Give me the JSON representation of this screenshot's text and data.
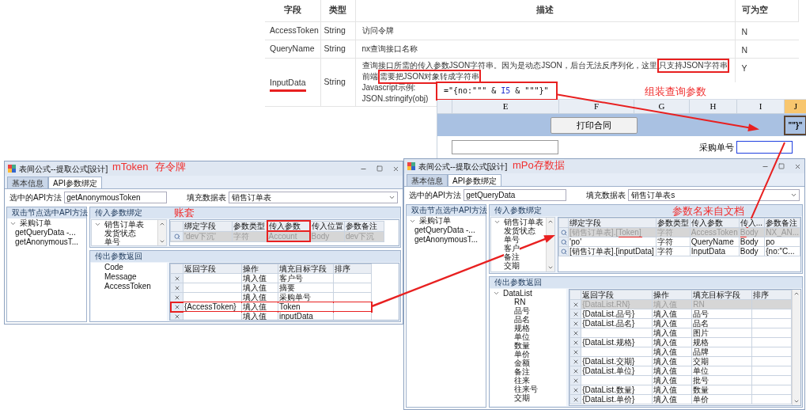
{
  "doc_table": {
    "columns": [
      "字段",
      "类型",
      "描述",
      "可为空"
    ],
    "rows": [
      {
        "field": "AccessToken",
        "type": "String",
        "description": [
          [
            {
              "text": "访问令牌",
              "highlighted": false
            }
          ]
        ],
        "nullable": "N",
        "underlined": false
      },
      {
        "field": "QueryName",
        "type": "String",
        "description": [
          [
            {
              "text": "nx查询接口名称",
              "highlighted": false
            }
          ]
        ],
        "nullable": "N",
        "underlined": false
      },
      {
        "field": "InputData",
        "type": "String",
        "description": [
          [
            {
              "text": "查询接口所需的传入参数JSON字符串。因为是动态JSON，后台无法反序列化，这里",
              "highlighted": false
            },
            {
              "text": "只支持JSON字符串",
              "highlighted": true
            }
          ],
          [
            {
              "text": "前端",
              "highlighted": false
            },
            {
              "text": "需要把JSON对象转成字符串",
              "highlighted": true
            }
          ],
          [
            {
              "text": "Javascript示例:",
              "highlighted": false
            }
          ],
          [
            {
              "text": "JSON.stringify(obj)",
              "highlighted": false
            }
          ]
        ],
        "nullable": "Y",
        "underlined": true
      }
    ]
  },
  "spreadsheet": {
    "formula": [
      {
        "text": "=\"{no:\"\"\" & ",
        "kind": "text"
      },
      {
        "text": "I5",
        "kind": "ref"
      },
      {
        "text": " & \"\"\"}\"",
        "kind": "text"
      }
    ],
    "formula_highlighted": true,
    "columns": [
      {
        "label": "E",
        "selected": false
      },
      {
        "label": "F",
        "selected": false
      },
      {
        "label": "G",
        "selected": false
      },
      {
        "label": "H",
        "selected": false
      },
      {
        "label": "I",
        "selected": false
      },
      {
        "label": "J",
        "selected": true
      }
    ],
    "button": "打印合同",
    "cell_text": "\"\"}\"",
    "field_label": "采购单号"
  },
  "windows": [
    {
      "title": "表间公式--提取公式[设计]",
      "tabs": [
        {
          "label": "基本信息",
          "selected": false
        },
        {
          "label": "API参数绑定",
          "selected": true
        }
      ],
      "api_method": {
        "label": "选中的API方法",
        "value": "getAnonymousToken"
      },
      "fill_table": {
        "label": "填充数据表",
        "value": "销售订单表"
      },
      "method_panel": {
        "title": "双击节点选中API方法",
        "tree": [
          {
            "label": "采购订单",
            "expanded": true,
            "children": [
              {
                "label": "getQueryData -..."
              },
              {
                "label": "getAnonymousT..."
              }
            ]
          }
        ]
      },
      "input_panel": {
        "title": "传入参数绑定",
        "tree": [
          {
            "label": "销售订单表",
            "expanded": true,
            "children": [
              {
                "label": "发货状态"
              },
              {
                "label": "单号"
              }
            ]
          }
        ],
        "columns": [
          {
            "label": "绑定字段",
            "highlighted": false
          },
          {
            "label": "参数类型",
            "highlighted": false
          },
          {
            "label": "传入参数",
            "highlighted": true
          },
          {
            "label": "传入位置",
            "highlighted": false
          },
          {
            "label": "参数备注",
            "highlighted": false
          }
        ],
        "rows": [
          {
            "cells": [
              "'dev下沉'",
              "字符",
              "Account",
              "Body",
              "dev下沉"
            ],
            "selected": true,
            "highlighted": false
          }
        ]
      },
      "output_panel": {
        "title": "传出参数返回",
        "tree": [
          {
            "label": "Code"
          },
          {
            "label": "Message"
          },
          {
            "label": "AccessToken"
          }
        ],
        "columns": [
          {
            "label": "返回字段",
            "highlighted": false
          },
          {
            "label": "操作",
            "highlighted": false
          },
          {
            "label": "填充目标字段",
            "highlighted": false
          },
          {
            "label": "排序",
            "highlighted": false
          }
        ],
        "rows": [
          {
            "cells": [
              "",
              "填入值",
              "客户号",
              ""
            ],
            "selected": false,
            "highlighted": false
          },
          {
            "cells": [
              "",
              "填入值",
              "摘要",
              ""
            ],
            "selected": false,
            "highlighted": false
          },
          {
            "cells": [
              "",
              "填入值",
              "采购单号",
              ""
            ],
            "selected": false,
            "highlighted": false
          },
          {
            "cells": [
              "{AccessToken}",
              "填入值",
              "Token",
              ""
            ],
            "selected": false,
            "highlighted": true
          },
          {
            "cells": [
              "",
              "填入值",
              "inputData",
              ""
            ],
            "selected": false,
            "highlighted": false
          }
        ]
      }
    },
    {
      "title": "表间公式--提取公式[设计]",
      "tabs": [
        {
          "label": "基本信息",
          "selected": false
        },
        {
          "label": "API参数绑定",
          "selected": true
        }
      ],
      "api_method": {
        "label": "选中的API方法",
        "value": "getQueryData"
      },
      "fill_table": {
        "label": "填充数据表",
        "value": "销售订单表s"
      },
      "method_panel": {
        "title": "双击节点选中API方法",
        "tree": [
          {
            "label": "采购订单",
            "expanded": true,
            "children": [
              {
                "label": "getQueryData -..."
              },
              {
                "label": "getAnonymousT..."
              }
            ]
          }
        ]
      },
      "input_panel": {
        "title": "传入参数绑定",
        "tree": [
          {
            "label": "销售订单表",
            "expanded": true,
            "children": [
              {
                "label": "发货状态"
              },
              {
                "label": "单号"
              },
              {
                "label": "客户"
              },
              {
                "label": "备注"
              },
              {
                "label": "交期"
              }
            ]
          }
        ],
        "columns": [
          {
            "label": "绑定字段",
            "highlighted": false
          },
          {
            "label": "参数类型",
            "highlighted": false
          },
          {
            "label": "传入参数",
            "highlighted": false
          },
          {
            "label": "传入...",
            "highlighted": false
          },
          {
            "label": "参数备注",
            "highlighted": false
          }
        ],
        "rows": [
          {
            "cells": [
              "[销售订单表].[Token]",
              "字符",
              "AccessToken",
              "Body",
              "NX_AN..."
            ],
            "selected": true,
            "highlighted": false
          },
          {
            "cells": [
              "'po'",
              "字符",
              "QueryName",
              "Body",
              "po"
            ],
            "selected": false,
            "highlighted": false
          },
          {
            "cells": [
              "[销售订单表].[inputData]",
              "字符",
              "InputData",
              "Body",
              "{no:\"C..."
            ],
            "selected": false,
            "highlighted": false
          }
        ]
      },
      "output_panel": {
        "title": "传出参数返回",
        "tree": [
          {
            "label": "DataList",
            "expanded": true,
            "children": [
              {
                "label": "RN"
              },
              {
                "label": "品号"
              },
              {
                "label": "品名"
              },
              {
                "label": "规格"
              },
              {
                "label": "单位"
              },
              {
                "label": "数量"
              },
              {
                "label": "单价"
              },
              {
                "label": "金额"
              },
              {
                "label": "备注"
              },
              {
                "label": "往来"
              },
              {
                "label": "往来号"
              },
              {
                "label": "交期"
              }
            ]
          }
        ],
        "columns": [
          {
            "label": "返回字段",
            "highlighted": false
          },
          {
            "label": "操作",
            "highlighted": false
          },
          {
            "label": "填充目标字段",
            "highlighted": false
          },
          {
            "label": "排序",
            "highlighted": false
          }
        ],
        "rows": [
          {
            "cells": [
              "{DataList.RN}",
              "填入值",
              "RN",
              ""
            ],
            "selected": true,
            "highlighted": false
          },
          {
            "cells": [
              "{DataList.品号}",
              "填入值",
              "品号",
              ""
            ],
            "selected": false,
            "highlighted": false
          },
          {
            "cells": [
              "{DataList.品名}",
              "填入值",
              "品名",
              ""
            ],
            "selected": false,
            "highlighted": false
          },
          {
            "cells": [
              "",
              "填入值",
              "图片",
              ""
            ],
            "selected": false,
            "highlighted": false
          },
          {
            "cells": [
              "{DataList.规格}",
              "填入值",
              "规格",
              ""
            ],
            "selected": false,
            "highlighted": false
          },
          {
            "cells": [
              "",
              "填入值",
              "品牌",
              ""
            ],
            "selected": false,
            "highlighted": false
          },
          {
            "cells": [
              "{DataList.交期}",
              "填入值",
              "交期",
              ""
            ],
            "selected": false,
            "highlighted": false
          },
          {
            "cells": [
              "{DataList.单位}",
              "填入值",
              "单位",
              ""
            ],
            "selected": false,
            "highlighted": false
          },
          {
            "cells": [
              "",
              "填入值",
              "批号",
              ""
            ],
            "selected": false,
            "highlighted": false
          },
          {
            "cells": [
              "{DataList.数量}",
              "填入值",
              "数量",
              ""
            ],
            "selected": false,
            "highlighted": false
          },
          {
            "cells": [
              "{DataList.单价}",
              "填入值",
              "单价",
              ""
            ],
            "selected": false,
            "highlighted": false
          }
        ]
      }
    }
  ],
  "annotations": [
    {
      "text": "组装查询参数"
    },
    {
      "text": "mToken"
    },
    {
      "text": "存令牌"
    },
    {
      "text": "账套"
    },
    {
      "text": "mPo存数据"
    },
    {
      "text": "参数名来自文档"
    }
  ]
}
